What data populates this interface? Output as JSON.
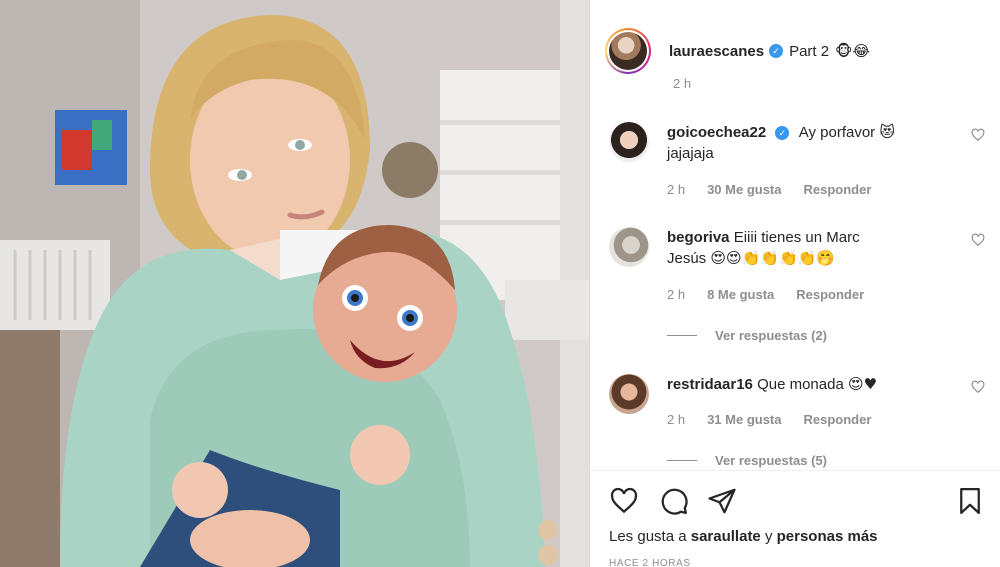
{
  "post": {
    "author": "lauraescanes",
    "caption": "Part 2",
    "caption_emojis": "🐵😂",
    "time": "2 h"
  },
  "comments": [
    {
      "user": "goicoechea22",
      "verified": true,
      "text_line1": "Ay porfavor",
      "text_emoji1": "😻",
      "text_line2": "jajajaja",
      "time": "2 h",
      "likes": "30 Me gusta",
      "reply": "Responder"
    },
    {
      "user": "begoriva",
      "verified": false,
      "text_line1": "Eiiii tienes un Marc",
      "text_line2": "Jesús",
      "text_emoji2": "😍😍👏👏👏👏🤭",
      "time": "2 h",
      "likes": "8 Me gusta",
      "reply": "Responder",
      "view_replies": "Ver respuestas (2)"
    },
    {
      "user": "restridaar16",
      "verified": false,
      "text_line1": "Que monada",
      "text_emoji1": "😍♥",
      "time": "2 h",
      "likes": "31 Me gusta",
      "reply": "Responder",
      "view_replies": "Ver respuestas (5)"
    }
  ],
  "likes_line": {
    "prefix": "Les gusta a",
    "user": "saraullate",
    "middle": "y",
    "suffix": "personas más"
  },
  "timestamp": "HACE 2 HORAS",
  "icons": [
    "heart-icon",
    "comment-icon",
    "share-icon",
    "bookmark-icon",
    "verified-badge-icon"
  ]
}
